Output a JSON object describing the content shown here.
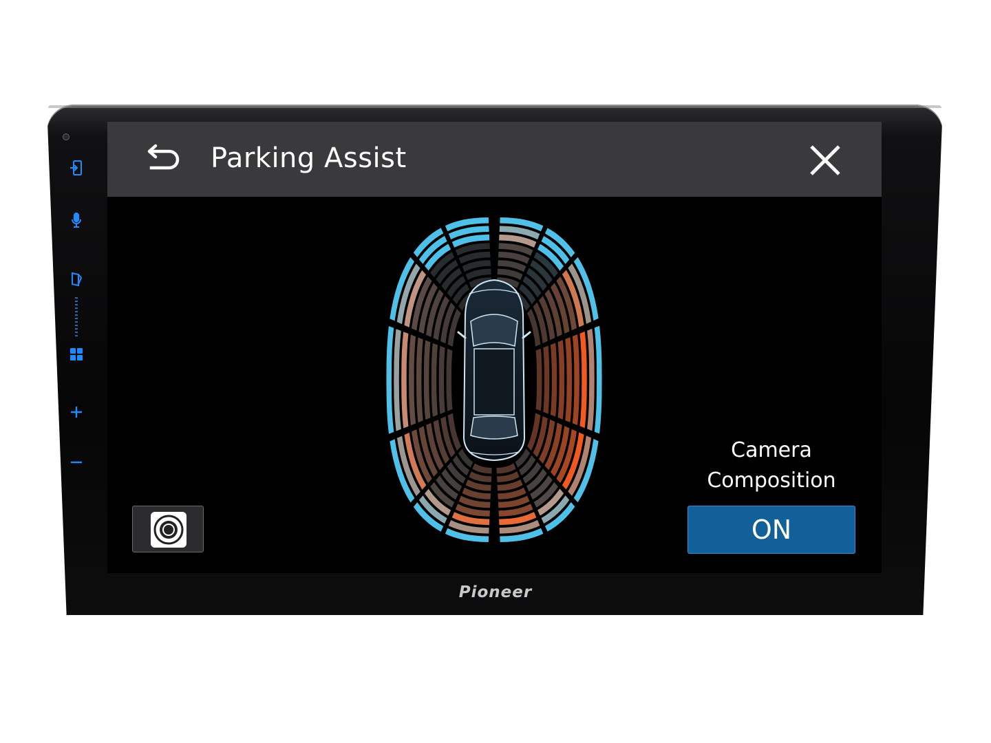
{
  "device": {
    "brand": "Pioneer",
    "side_buttons": [
      {
        "name": "source-icon"
      },
      {
        "name": "microphone-icon"
      },
      {
        "name": "phone-link-icon"
      },
      {
        "name": "apps-grid-icon"
      },
      {
        "name": "volume-up-icon"
      },
      {
        "name": "volume-down-icon"
      }
    ],
    "accent_color": "#1e8cff"
  },
  "header": {
    "title": "Parking Assist",
    "back_icon": "back-arrow-icon",
    "close_icon": "close-icon",
    "background": "#3a3a3d"
  },
  "parking_radar": {
    "front_sectors": [
      {
        "outer_bright": 1.0,
        "inner_intensity": 0.05,
        "color": "#4fc0e8"
      },
      {
        "outer_bright": 1.0,
        "inner_intensity": 0.05,
        "color": "#4fc0e8"
      },
      {
        "outer_bright": 1.0,
        "inner_intensity": 0.35,
        "color": "#b49a8c"
      },
      {
        "outer_bright": 1.0,
        "inner_intensity": 0.15,
        "color": "#4fc0e8"
      }
    ],
    "left_sectors": [
      {
        "outer_bright": 1.0,
        "inner_intensity": 0.45,
        "color": "#c09480"
      },
      {
        "outer_bright": 1.0,
        "inner_intensity": 0.5,
        "color": "#c88a70"
      },
      {
        "outer_bright": 1.0,
        "inner_intensity": 0.55,
        "color": "#d07a58"
      }
    ],
    "right_sectors": [
      {
        "outer_bright": 1.0,
        "inner_intensity": 0.55,
        "color": "#d0784f"
      },
      {
        "outer_bright": 1.0,
        "inner_intensity": 0.8,
        "color": "#f05a20"
      },
      {
        "outer_bright": 1.0,
        "inner_intensity": 0.85,
        "color": "#f05a20"
      }
    ],
    "rear_sectors": [
      {
        "outer_bright": 1.0,
        "inner_intensity": 0.35,
        "color": "#b49a8c"
      },
      {
        "outer_bright": 1.0,
        "inner_intensity": 0.6,
        "color": "#e07040"
      },
      {
        "outer_bright": 1.0,
        "inner_intensity": 0.65,
        "color": "#e86a34"
      },
      {
        "outer_bright": 1.0,
        "inner_intensity": 0.4,
        "color": "#b49a8c"
      }
    ]
  },
  "camera_button": {
    "icon": "camera-icon"
  },
  "camera_composition": {
    "label": "Camera\nComposition",
    "value": "ON",
    "button_color": "#12609a"
  }
}
